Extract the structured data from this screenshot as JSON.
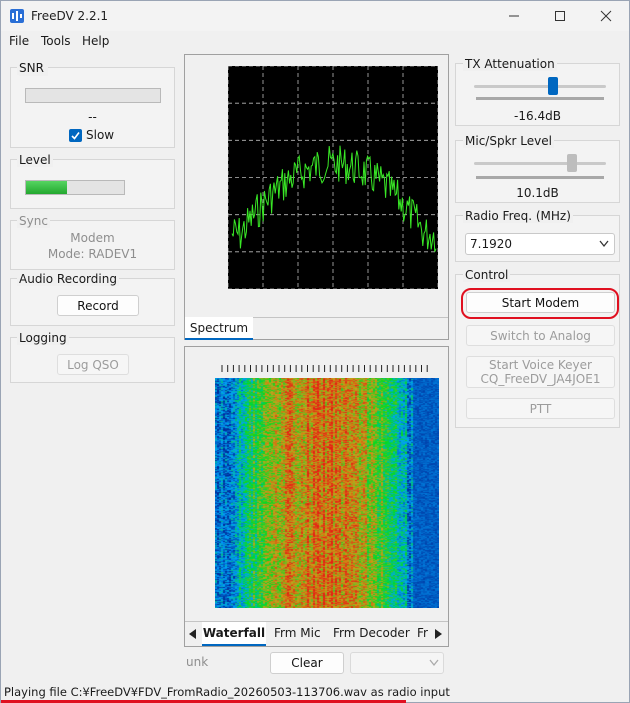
{
  "window": {
    "title": "FreeDV 2.2.1"
  },
  "menu": {
    "file": "File",
    "tools": "Tools",
    "help": "Help"
  },
  "snr": {
    "title": "SNR",
    "value": "--",
    "slow_label": "Slow",
    "slow_checked": true
  },
  "level": {
    "title": "Level",
    "fraction": 0.42
  },
  "sync": {
    "title": "Sync",
    "status": "Modem",
    "mode": "Mode: RADEV1"
  },
  "audio_recording": {
    "title": "Audio Recording",
    "record_label": "Record"
  },
  "logging": {
    "title": "Logging",
    "log_qso_label": "Log QSO"
  },
  "tx_attenuation": {
    "title": "TX Attenuation",
    "value": "-16.4dB",
    "position": 0.6
  },
  "mic_level": {
    "title": "Mic/Spkr Level",
    "value": "10.1dB",
    "position": 0.74
  },
  "radio_freq": {
    "title": "Radio Freq. (MHz)",
    "value": "7.1920"
  },
  "control": {
    "title": "Control",
    "start_modem": "Start Modem",
    "switch_analog": "Switch to Analog",
    "voice_keyer_line1": "Start Voice Keyer",
    "voice_keyer_line2": "CQ_FreeDV_JA4JOE1",
    "ptt": "PTT"
  },
  "spectrum": {
    "tab_label": "Spectrum"
  },
  "waterfall": {
    "tabs": [
      "Waterfall",
      "Frm Mic",
      "Frm Decoder",
      "Fr"
    ]
  },
  "bottom": {
    "callsign": "unk",
    "clear_label": "Clear"
  },
  "status": {
    "text": "Playing file C:¥FreeDV¥FDV_FromRadio_20260503-113706.wav as radio input"
  },
  "colors": {
    "accent": "#0067c0",
    "highlight": "#e01020",
    "spectrum_trace": "#39e826",
    "level_fill": "#2db83a"
  }
}
